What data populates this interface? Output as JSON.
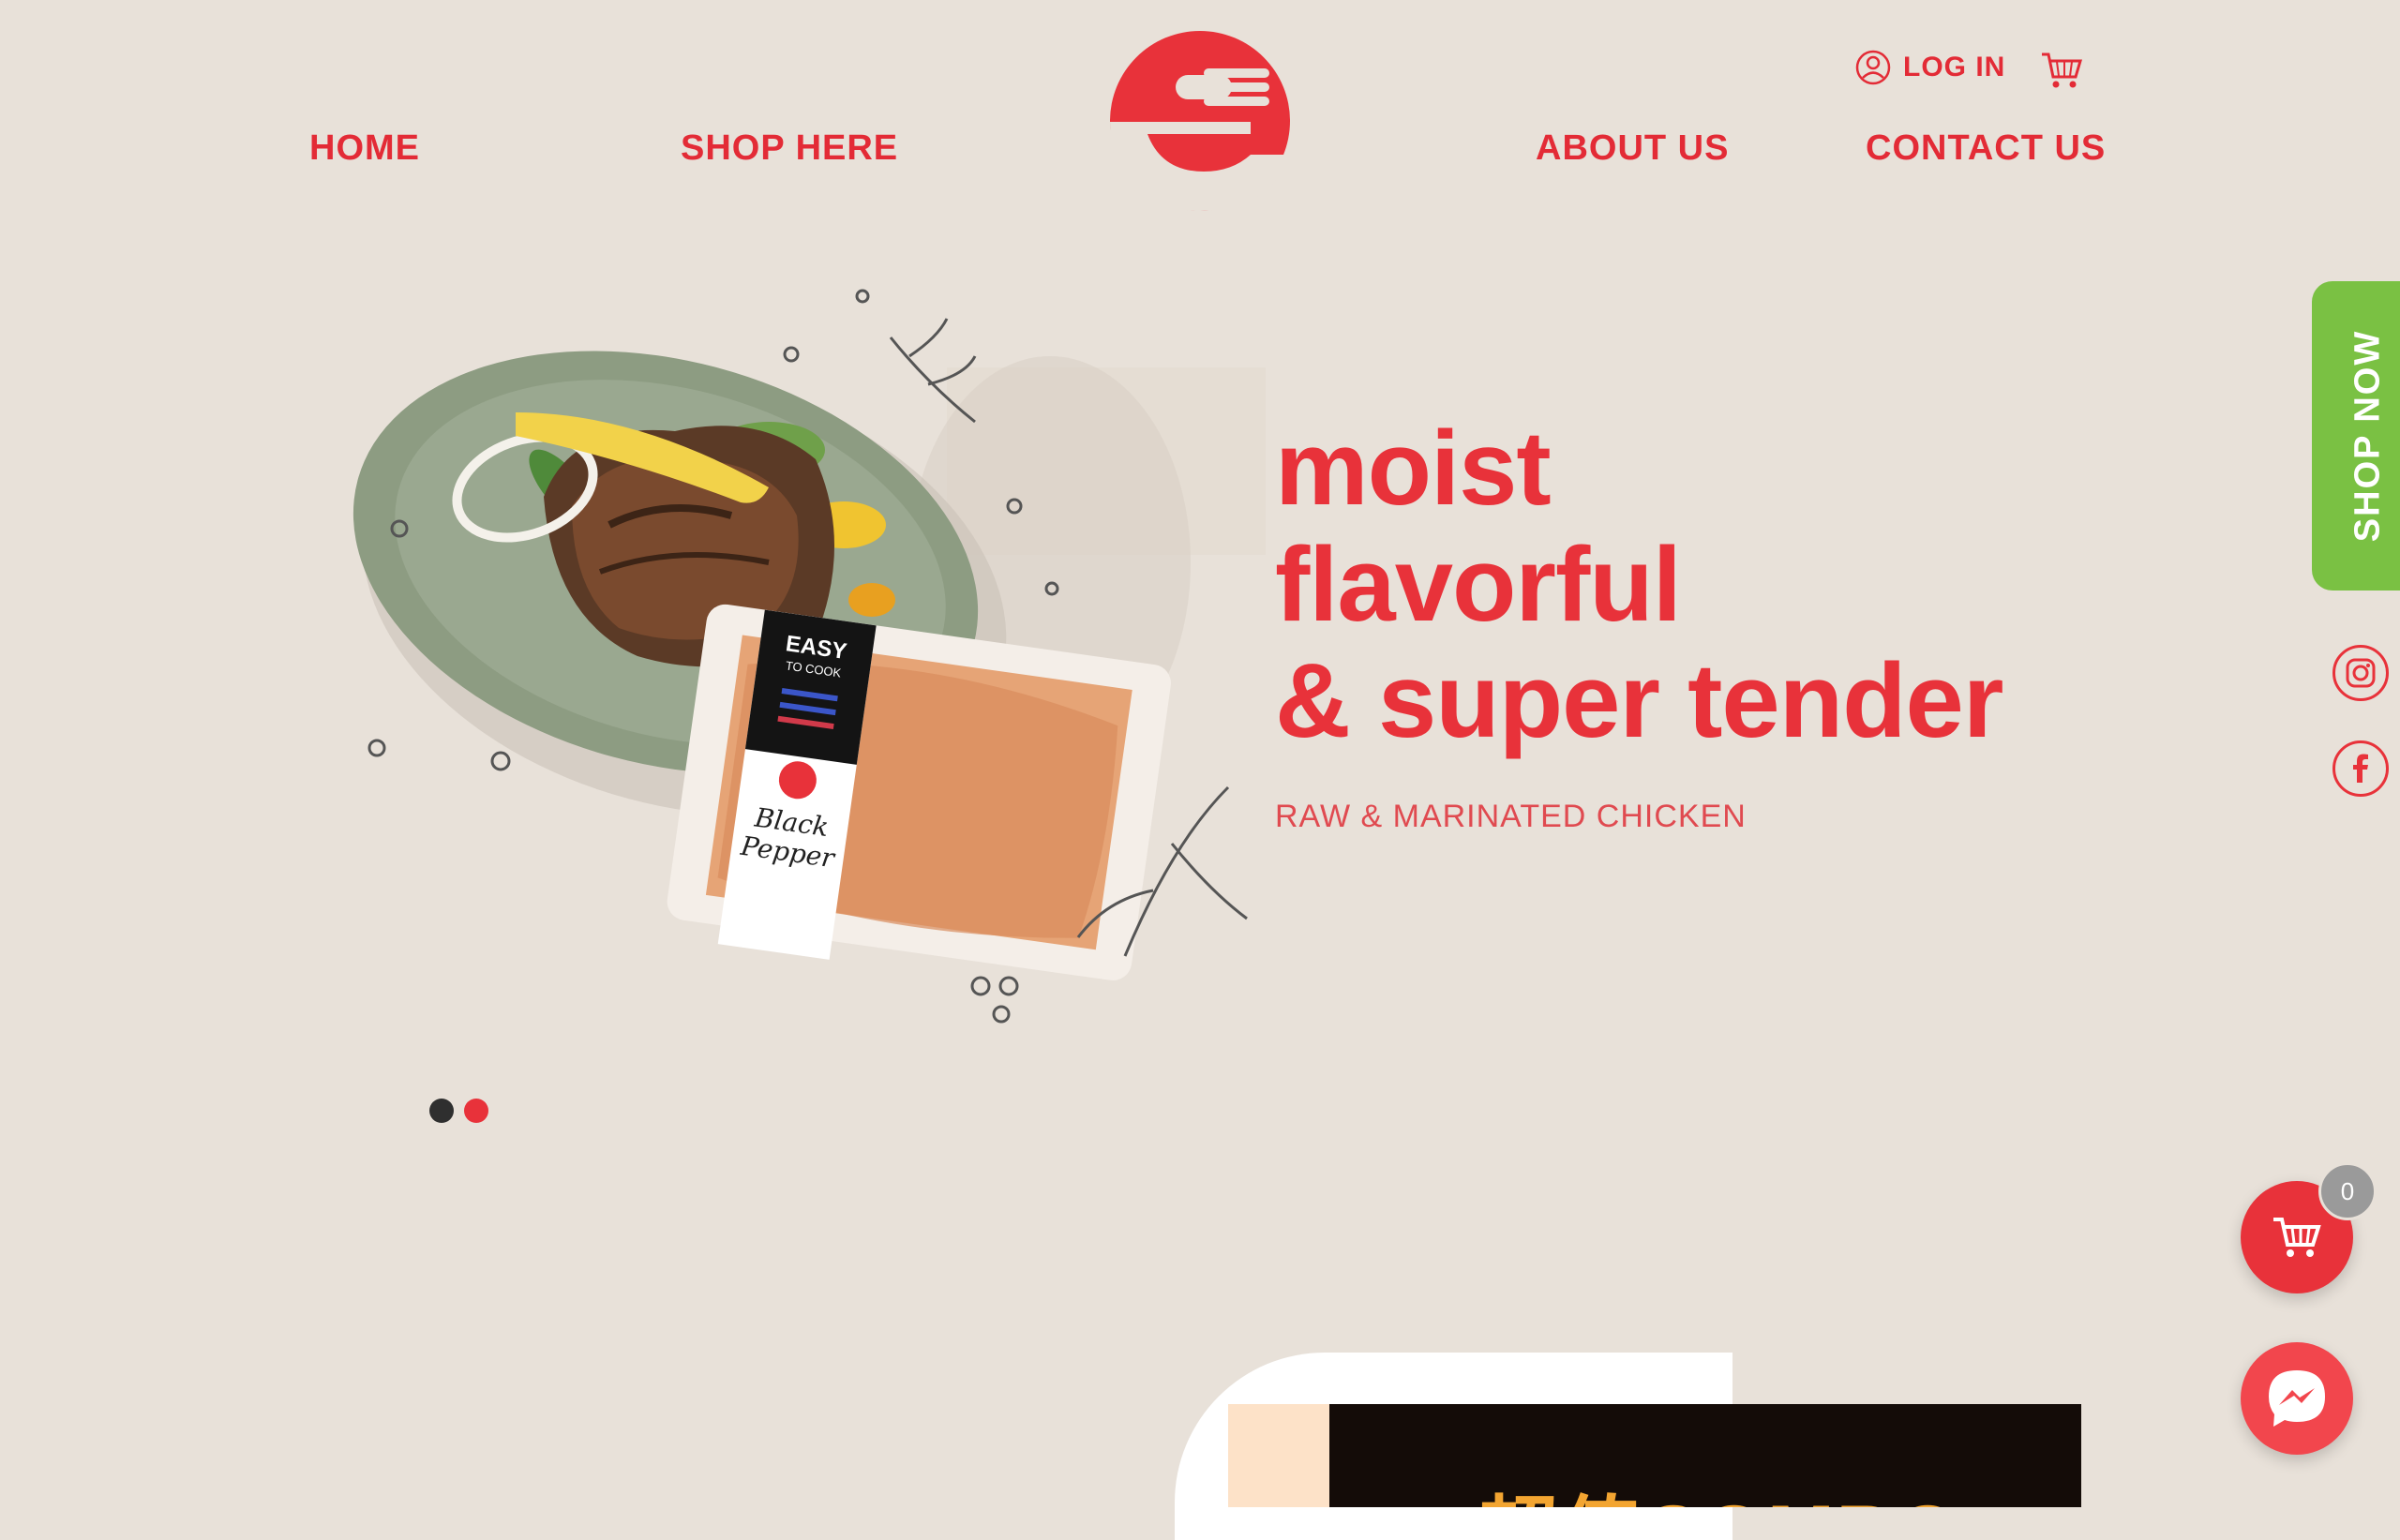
{
  "nav": {
    "home": "HOME",
    "shop": "SHOP HERE",
    "about": "ABOUT US",
    "contact": "CONTACT US"
  },
  "utility": {
    "login": "LOG IN"
  },
  "hero": {
    "line1": "moist",
    "line2": "flavorful",
    "line3": "& super tender",
    "subtitle": "RAW & MARINATED CHICKEN",
    "package_brand": "EASY",
    "package_brand_sub": "TO COOK",
    "package_flavor_1": "Black",
    "package_flavor_2": "Pepper"
  },
  "carousel": {
    "slides": 2,
    "active_index": 1
  },
  "side": {
    "shop_now": "SHOP NOW"
  },
  "cart": {
    "count": "0"
  },
  "banner": {
    "text": "超值COMBO"
  },
  "colors": {
    "brand_red": "#e8323a",
    "background": "#e8e1d9",
    "shop_now_green": "#7ac143"
  },
  "icons": [
    "user-icon",
    "cart-icon",
    "instagram-icon",
    "facebook-icon",
    "messenger-icon"
  ]
}
